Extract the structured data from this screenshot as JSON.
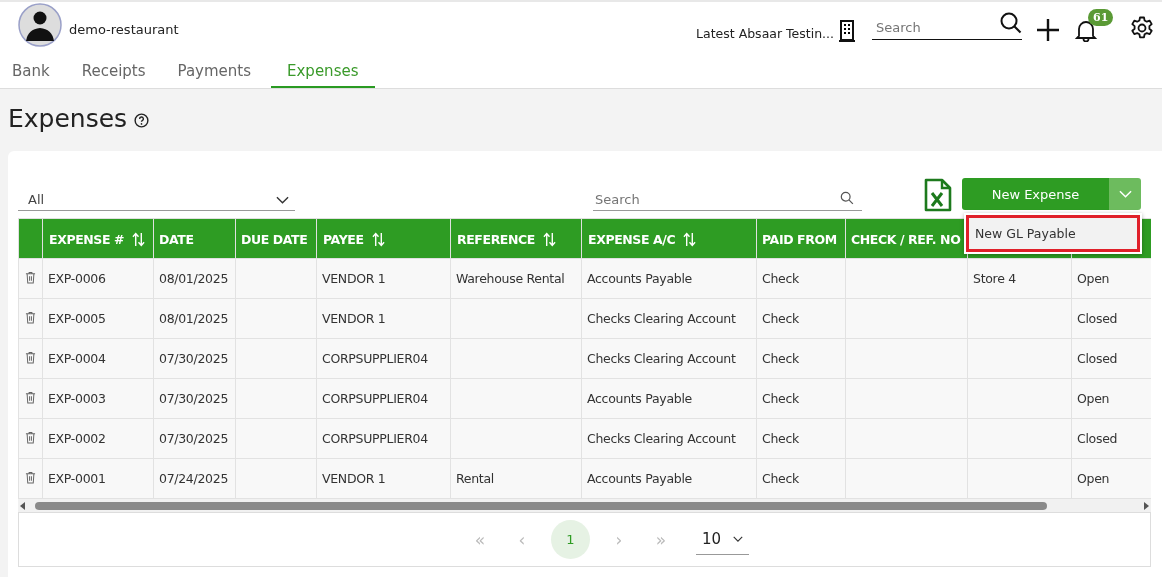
{
  "header": {
    "company": "demo-restaurant",
    "location": "Latest Absaar Testin...",
    "search": {
      "placeholder": "Search"
    },
    "notifications": "61"
  },
  "tabs": [
    {
      "label": "Bank",
      "selected": false
    },
    {
      "label": "Receipts",
      "selected": false
    },
    {
      "label": "Payments",
      "selected": false
    },
    {
      "label": "Expenses",
      "selected": true
    }
  ],
  "page": {
    "title": "Expenses"
  },
  "toolbar": {
    "filter": "All",
    "search": {
      "placeholder": "Search"
    },
    "new_button": "New Expense",
    "menu": [
      {
        "label": "New GL Payable",
        "highlighted": true
      }
    ]
  },
  "table": {
    "columns": [
      {
        "label": "EXPENSE #",
        "sortable": true
      },
      {
        "label": "DATE",
        "sortable": false
      },
      {
        "label": "DUE DATE",
        "sortable": false
      },
      {
        "label": "PAYEE",
        "sortable": true
      },
      {
        "label": "REFERENCE",
        "sortable": true
      },
      {
        "label": "EXPENSE A/C",
        "sortable": true
      },
      {
        "label": "PAID FROM",
        "sortable": false
      },
      {
        "label": "CHECK / REF. NO",
        "sortable": false
      }
    ],
    "rows": [
      {
        "expense_no": "EXP-0006",
        "date": "08/01/2025",
        "payee": "VENDOR 1",
        "reference": "Warehouse Rental",
        "expense_account": "Accounts Payable",
        "paid_from": "Check",
        "column_9": "Store 4",
        "column_10": "Open"
      },
      {
        "expense_no": "EXP-0005",
        "date": "08/01/2025",
        "payee": "VENDOR 1",
        "expense_account": "Checks Clearing Account",
        "paid_from": "Check",
        "column_10": "Closed"
      },
      {
        "expense_no": "EXP-0004",
        "date": "07/30/2025",
        "payee": "CORPSUPPLIER04",
        "expense_account": "Checks Clearing Account",
        "paid_from": "Check",
        "column_10": "Closed"
      },
      {
        "expense_no": "EXP-0003",
        "date": "07/30/2025",
        "payee": "CORPSUPPLIER04",
        "expense_account": "Accounts Payable",
        "paid_from": "Check",
        "column_10": "Open"
      },
      {
        "expense_no": "EXP-0002",
        "date": "07/30/2025",
        "payee": "CORPSUPPLIER04",
        "expense_account": "Checks Clearing Account",
        "paid_from": "Check",
        "column_10": "Closed"
      },
      {
        "expense_no": "EXP-0001",
        "date": "07/24/2025",
        "payee": "VENDOR 1",
        "reference": "Rental",
        "expense_account": "Accounts Payable",
        "paid_from": "Check",
        "column_10": "Open"
      }
    ]
  },
  "pagination": {
    "first": "«",
    "prev": "‹",
    "pages": [
      {
        "label": "1",
        "selected": true
      }
    ],
    "next": "›",
    "last": "»",
    "page_size": "10"
  }
}
